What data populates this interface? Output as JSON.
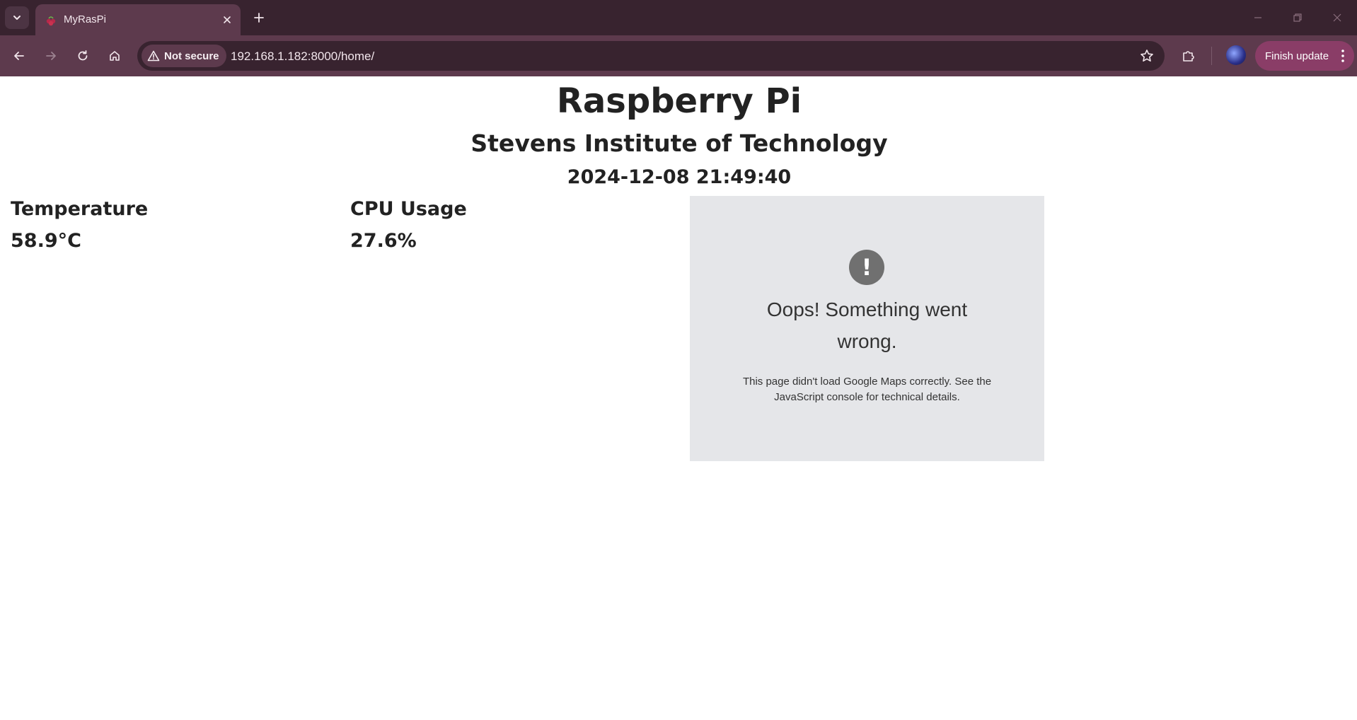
{
  "browser": {
    "tab": {
      "title": "MyRasPi"
    },
    "address": {
      "security_label": "Not secure",
      "url": "192.168.1.182:8000/home/"
    },
    "update_button": {
      "label": "Finish update"
    }
  },
  "page": {
    "title": "Raspberry Pi",
    "subtitle": "Stevens Institute of Technology",
    "timestamp": "2024-12-08 21:49:40",
    "stats": [
      {
        "label": "Temperature",
        "value": "58.9°C"
      },
      {
        "label": "CPU Usage",
        "value": "27.6%"
      }
    ],
    "map_error": {
      "icon": "exclamation-icon",
      "title": "Oops! Something went wrong.",
      "description": "This page didn't load Google Maps correctly. See the JavaScript console for technical details."
    }
  },
  "colors": {
    "tabstrip": "#38232f",
    "toolbar": "#5d3a4d",
    "update_button": "#8a3d67",
    "map_placeholder": "#e5e6e9"
  }
}
